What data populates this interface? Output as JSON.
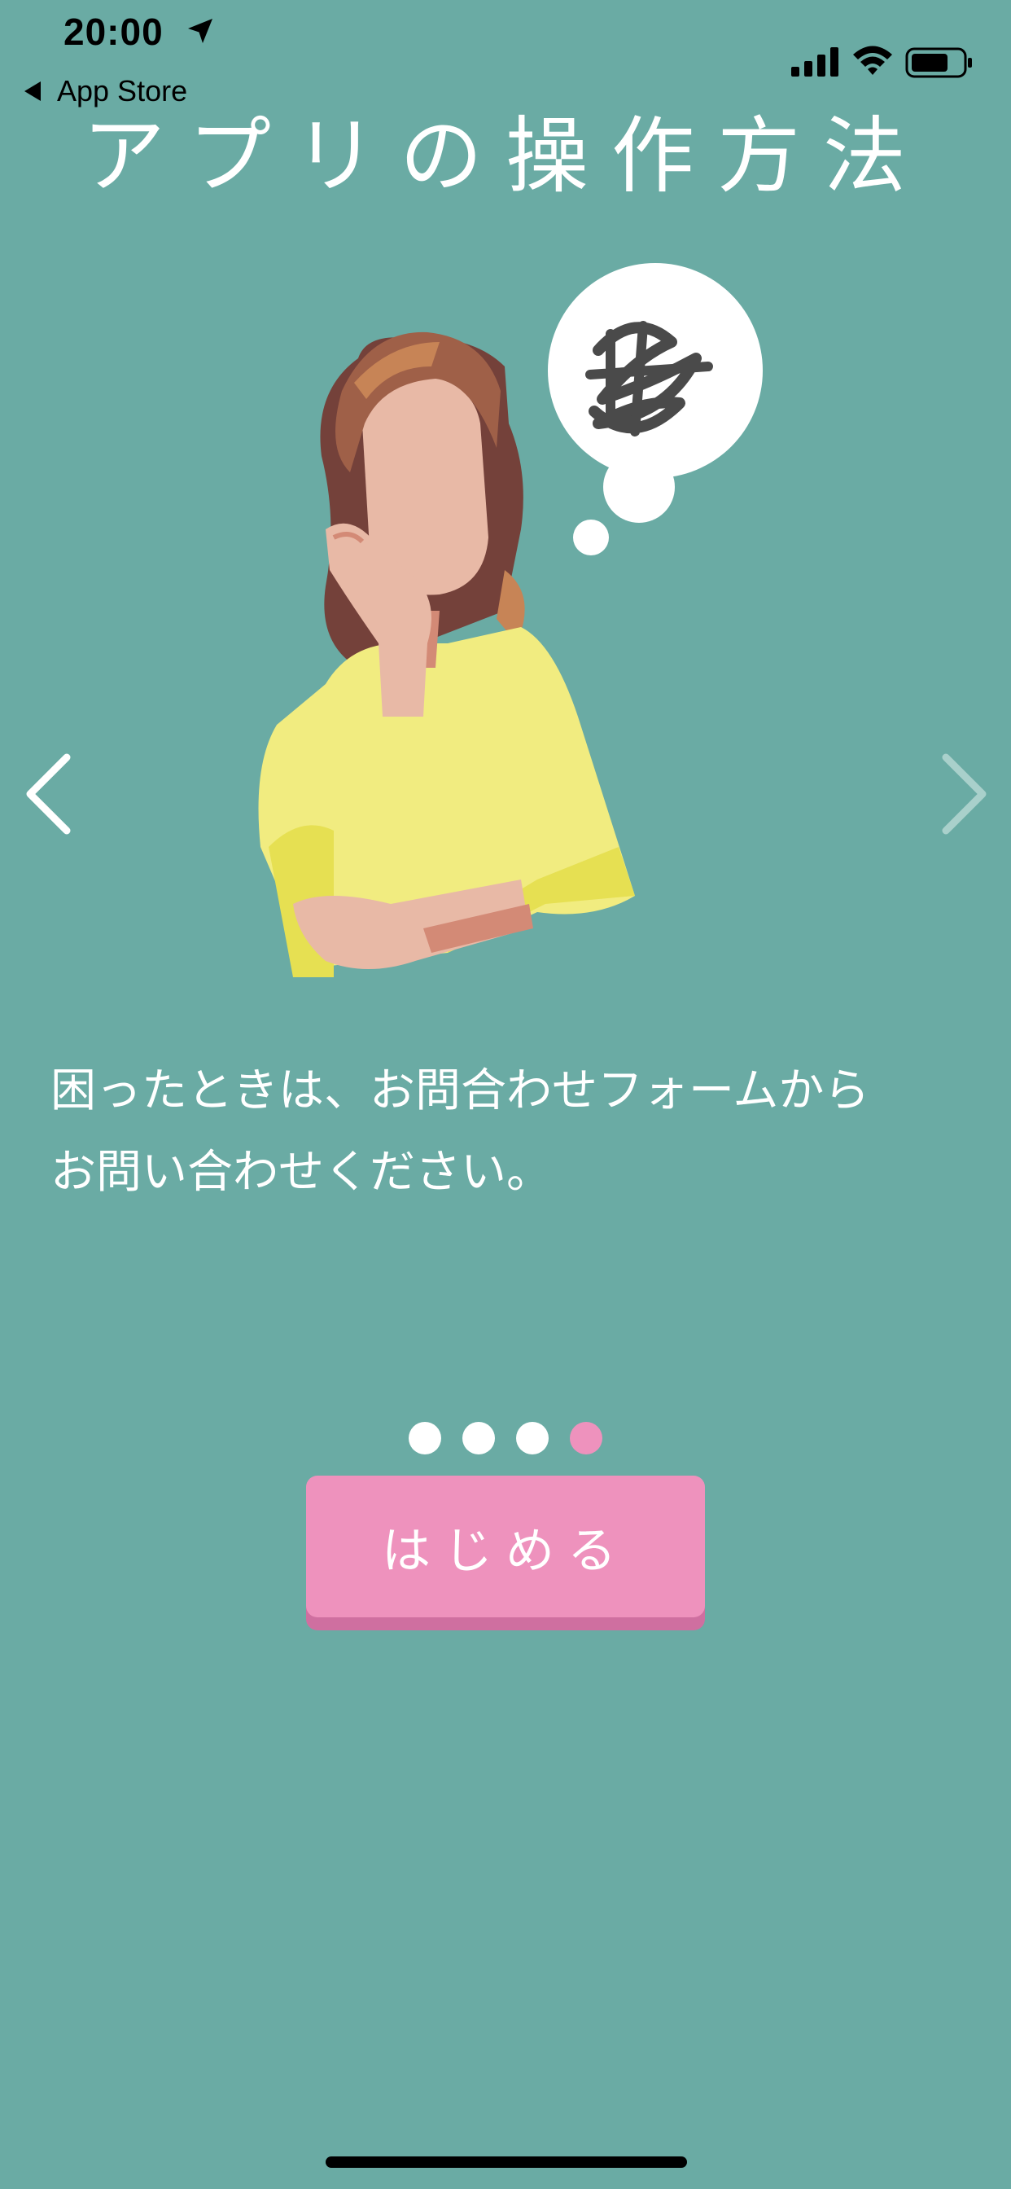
{
  "status_bar": {
    "time": "20:00",
    "back_label": "App Store"
  },
  "title": "アプリの操作方法",
  "message_lines": [
    "困ったときは、お問合わせフォームから",
    "お問い合わせください。"
  ],
  "pagination": {
    "total": 4,
    "current": 4
  },
  "start_button_label": "はじめる",
  "colors": {
    "background": "#6aaba4",
    "accent": "#ee92bd",
    "accent_shadow": "#cf6fa0"
  },
  "icons": [
    "location-arrow-icon",
    "signal-icon",
    "wifi-icon",
    "battery-icon",
    "chevron-left-icon",
    "chevron-right-icon"
  ]
}
